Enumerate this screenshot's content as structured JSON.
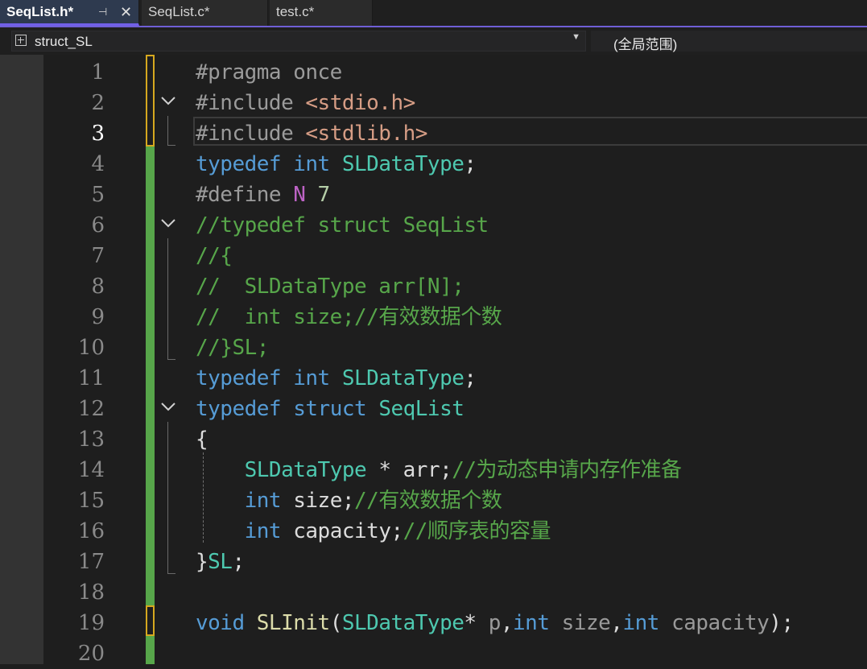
{
  "tabs": [
    {
      "label": "SeqList.h*",
      "active": true
    },
    {
      "label": "SeqList.c*",
      "active": false
    },
    {
      "label": "test.c*",
      "active": false
    }
  ],
  "tab_icons": {
    "pin": "pin-icon",
    "close": "close-icon"
  },
  "navbar": {
    "scope": "struct_SL",
    "member": "(全局范围)"
  },
  "editor": {
    "current_line": 3,
    "line_numbers": [
      "1",
      "2",
      "3",
      "4",
      "5",
      "6",
      "7",
      "8",
      "9",
      "10",
      "11",
      "12",
      "13",
      "14",
      "15",
      "16",
      "17",
      "18",
      "19",
      "20"
    ],
    "lines": [
      [
        [
          "pp",
          "#pragma once"
        ]
      ],
      [
        [
          "pp",
          "#include "
        ],
        [
          "str",
          "<stdio.h>"
        ]
      ],
      [
        [
          "pp",
          "#include "
        ],
        [
          "str",
          "<stdlib.h>"
        ]
      ],
      [
        [
          "kw",
          "typedef "
        ],
        [
          "kw",
          "int "
        ],
        [
          "ty",
          "SLDataType"
        ],
        [
          "pl",
          ";"
        ]
      ],
      [
        [
          "pp",
          "#define "
        ],
        [
          "mac",
          "N "
        ],
        [
          "num",
          "7"
        ]
      ],
      [
        [
          "cm",
          "//typedef struct SeqList"
        ]
      ],
      [
        [
          "cm",
          "//{"
        ]
      ],
      [
        [
          "cm",
          "//  SLDataType arr[N];"
        ]
      ],
      [
        [
          "cm",
          "//  int size;//有效数据个数"
        ]
      ],
      [
        [
          "cm",
          "//}SL;"
        ]
      ],
      [
        [
          "kw",
          "typedef "
        ],
        [
          "kw",
          "int "
        ],
        [
          "ty",
          "SLDataType"
        ],
        [
          "pl",
          ";"
        ]
      ],
      [
        [
          "kw",
          "typedef "
        ],
        [
          "kw",
          "struct "
        ],
        [
          "ty",
          "SeqList"
        ]
      ],
      [
        [
          "pl",
          "{"
        ]
      ],
      [
        [
          "pl",
          "    "
        ],
        [
          "ty",
          "SLDataType"
        ],
        [
          "pl",
          " * arr;"
        ],
        [
          "cm",
          "//为动态申请内存作准备"
        ]
      ],
      [
        [
          "pl",
          "    "
        ],
        [
          "kw",
          "int "
        ],
        [
          "pl",
          "size;"
        ],
        [
          "cm",
          "//有效数据个数"
        ]
      ],
      [
        [
          "pl",
          "    "
        ],
        [
          "kw",
          "int "
        ],
        [
          "pl",
          "capacity;"
        ],
        [
          "cm",
          "//顺序表的容量"
        ]
      ],
      [
        [
          "pl",
          "}"
        ],
        [
          "ty",
          "SL"
        ],
        [
          "pl",
          ";"
        ]
      ],
      [
        [
          "pl",
          ""
        ]
      ],
      [
        [
          "kw",
          "void "
        ],
        [
          "fn",
          "SLInit"
        ],
        [
          "pl",
          "("
        ],
        [
          "ty",
          "SLDataType"
        ],
        [
          "pl",
          "* "
        ],
        [
          "pr",
          "p"
        ],
        [
          "pl",
          ","
        ],
        [
          "kw",
          "int "
        ],
        [
          "pr",
          "size"
        ],
        [
          "pl",
          ","
        ],
        [
          "kw",
          "int "
        ],
        [
          "pr",
          "capacity"
        ],
        [
          "pl",
          ");"
        ]
      ],
      [
        [
          "pl",
          ""
        ]
      ]
    ]
  },
  "colors": {
    "accent": "#7160e8",
    "saved_change": "#57a64a",
    "unsaved_change": "#d6a81f"
  }
}
